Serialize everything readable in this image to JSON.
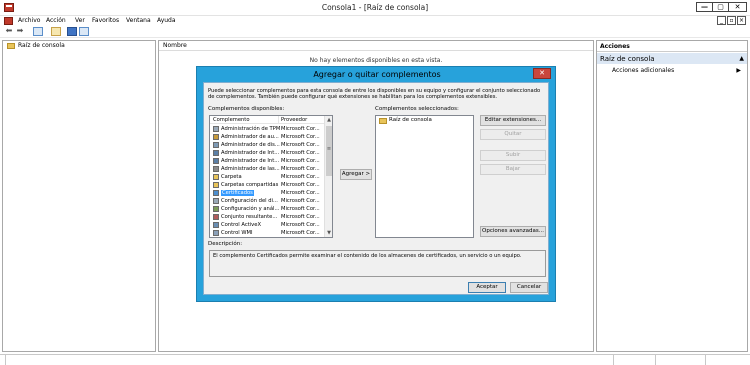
{
  "window": {
    "title": "Consola1 - [Raíz de consola]",
    "min_glyph": "—",
    "max_glyph": "▢",
    "close_glyph": "✕"
  },
  "menubar": {
    "items": [
      "Archivo",
      "Acción",
      "Ver",
      "Favoritos",
      "Ventana",
      "Ayuda"
    ],
    "mdi_buttons": [
      "_",
      "▫",
      "×"
    ]
  },
  "toolbar": {
    "back_glyph": "⬅",
    "forward_glyph": "➡",
    "icons": [
      "back-icon",
      "forward-icon",
      "console-tree-icon",
      "export-list-icon",
      "help-icon",
      "show-hide-action-pane-icon"
    ]
  },
  "tree": {
    "root_label": "Raíz de consola"
  },
  "center": {
    "column_name": "Nombre",
    "empty_message": "No hay elementos disponibles en esta vista."
  },
  "actions": {
    "title": "Acciones",
    "section_label": "Raíz de consola",
    "more_actions": "Acciones adicionales",
    "section_arrow": "▲",
    "more_arrow": "▶"
  },
  "dialog": {
    "title": "Agregar o quitar complementos",
    "close_glyph": "✕",
    "intro": "Puede seleccionar complementos para esta consola de entre los disponibles en su equipo y configurar el conjunto seleccionado de complementos. También puede configurar qué extensiones se habilitan para los complementos extensibles.",
    "available_label": "Complementos disponibles:",
    "selected_label": "Complementos seleccionados:",
    "col_snapin": "Complemento",
    "col_vendor": "Proveedor",
    "available_items": [
      {
        "name": "Administración de TPM",
        "vendor": "Microsoft Cor...",
        "icon": "tpm-icon"
      },
      {
        "name": "Administrador de au...",
        "vendor": "Microsoft Cor...",
        "icon": "authorization-icon"
      },
      {
        "name": "Administrador de dis...",
        "vendor": "Microsoft Cor...",
        "icon": "disk-icon"
      },
      {
        "name": "Administrador de Int...",
        "vendor": "Microsoft Cor...",
        "icon": "security-icon"
      },
      {
        "name": "Administrador de Int...",
        "vendor": "Microsoft Cor...",
        "icon": "security-icon"
      },
      {
        "name": "Administrador de las...",
        "vendor": "Microsoft Cor...",
        "icon": "printer-icon"
      },
      {
        "name": "Carpeta",
        "vendor": "Microsoft Cor...",
        "icon": "folder-icon"
      },
      {
        "name": "Carpetas compartidas",
        "vendor": "Microsoft Cor...",
        "icon": "shared-folder-icon"
      },
      {
        "name": "Certificados",
        "vendor": "Microsoft Cor...",
        "icon": "certificate-icon",
        "selected": true
      },
      {
        "name": "Configuración del di...",
        "vendor": "Microsoft Cor...",
        "icon": "config-icon"
      },
      {
        "name": "Configuración y anál...",
        "vendor": "Microsoft Cor...",
        "icon": "analysis-icon"
      },
      {
        "name": "Conjunto resultante...",
        "vendor": "Microsoft Cor...",
        "icon": "policy-icon"
      },
      {
        "name": "Control ActiveX",
        "vendor": "Microsoft Cor...",
        "icon": "activex-icon"
      },
      {
        "name": "Control WMI",
        "vendor": "Microsoft Cor...",
        "icon": "wmi-icon"
      }
    ],
    "scroll_up": "▲",
    "scroll_down": "▼",
    "scroll_grip": "≡",
    "add_button": "Agregar >",
    "selected_items": [
      "Raíz de consola"
    ],
    "edit_extensions": "Editar extensiones...",
    "remove": "Quitar",
    "move_up": "Subir",
    "move_down": "Bajar",
    "advanced": "Opciones avanzadas...",
    "description_label": "Descripción:",
    "description": "El complemento Certificados permite examinar el contenido de los almacenes de certificados, un servicio o un equipo.",
    "ok": "Aceptar",
    "cancel": "Cancelar"
  },
  "colors": {
    "dialog_frame": "#27a2db",
    "selection": "#3399ff",
    "close_button": "#c9463d",
    "actions_section": "#dce7f4"
  }
}
